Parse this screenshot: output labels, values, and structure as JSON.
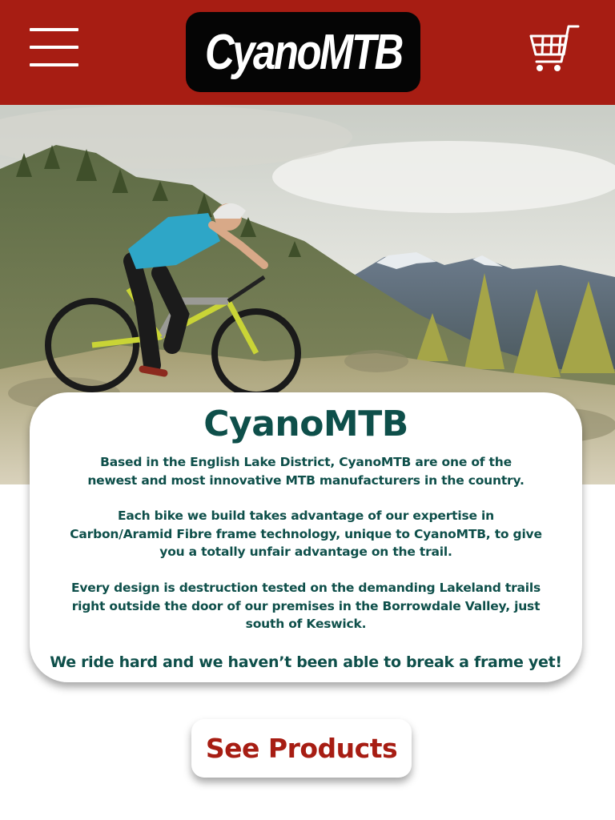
{
  "header": {
    "logo_text": "CyanoMTB",
    "menu_icon": "hamburger-menu-icon",
    "cart_icon": "shopping-cart-icon",
    "background_color": "#a71d13"
  },
  "hero": {
    "image_description_icon": "mountain-bike-rider-photo"
  },
  "intro": {
    "title": "CyanoMTB",
    "paragraph_1": "Based in the English Lake District, CyanoMTB are one of the newest and most innovative MTB manufacturers in the country.",
    "paragraph_2": "Each bike we build takes advantage of our expertise in Carbon/Aramid Fibre frame technology, unique to CyanoMTB, to give you a totally unfair advantage on the trail.",
    "paragraph_3": "Every design is destruction tested on the demanding Lakeland trails right outside the door of our premises in the Borrowdale Valley, just south of Keswick.",
    "tagline": "We ride hard and we haven’t been able to break a frame yet!",
    "text_color": "#0e4f4a"
  },
  "cta": {
    "label": "See Products",
    "text_color": "#a71d13"
  }
}
